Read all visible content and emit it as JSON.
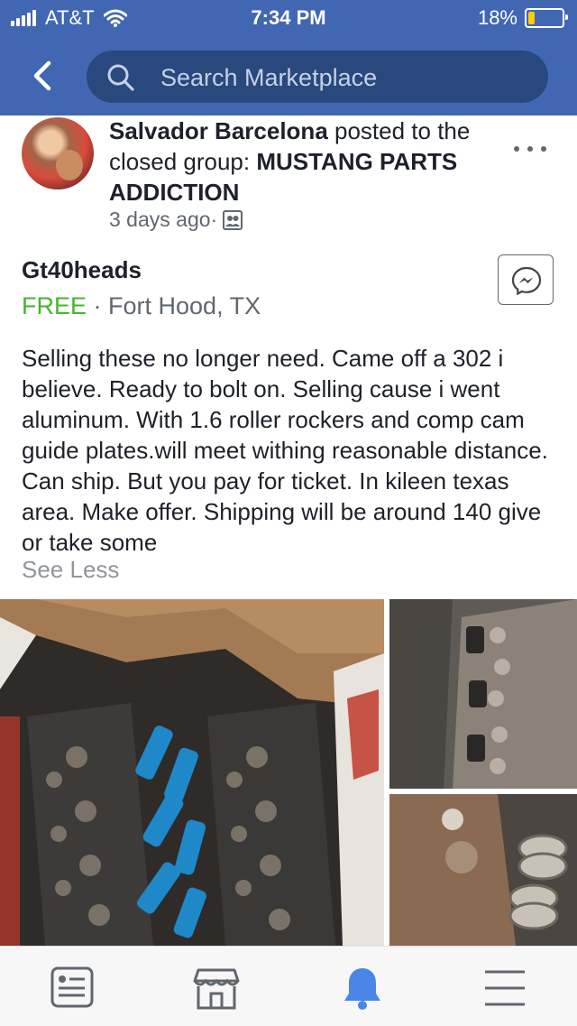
{
  "status_bar": {
    "carrier": "AT&T",
    "time": "7:34 PM",
    "battery": "18%",
    "battery_level": 0.18
  },
  "header": {
    "search_placeholder": "Search Marketplace"
  },
  "post": {
    "author": "Salvador Barcelona",
    "posted_to": " posted to the closed group: ",
    "group": "MUSTANG PARTS ADDICTION",
    "time": "3 days ago",
    "separator": " · "
  },
  "listing": {
    "title": "Gt40heads",
    "price": "FREE",
    "location_sep": " · ",
    "location": "Fort Hood, TX",
    "description": "Selling these no longer need. Came off a 302 i believe. Ready to bolt on. Selling cause i went aluminum. With 1.6 roller rockers and comp cam guide plates.will meet withing reasonable distance. Can ship. But you pay for ticket. In kileen texas area. Make offer. Shipping will be around 140 give or take some",
    "see_less": "See Less"
  },
  "colors": {
    "brand": "#4267b2",
    "price_green": "#42b72a",
    "notification_active": "#4a86e8"
  },
  "tabs": [
    {
      "icon": "news-feed-icon"
    },
    {
      "icon": "marketplace-icon"
    },
    {
      "icon": "notifications-bell-icon",
      "active": true
    },
    {
      "icon": "menu-icon"
    }
  ]
}
